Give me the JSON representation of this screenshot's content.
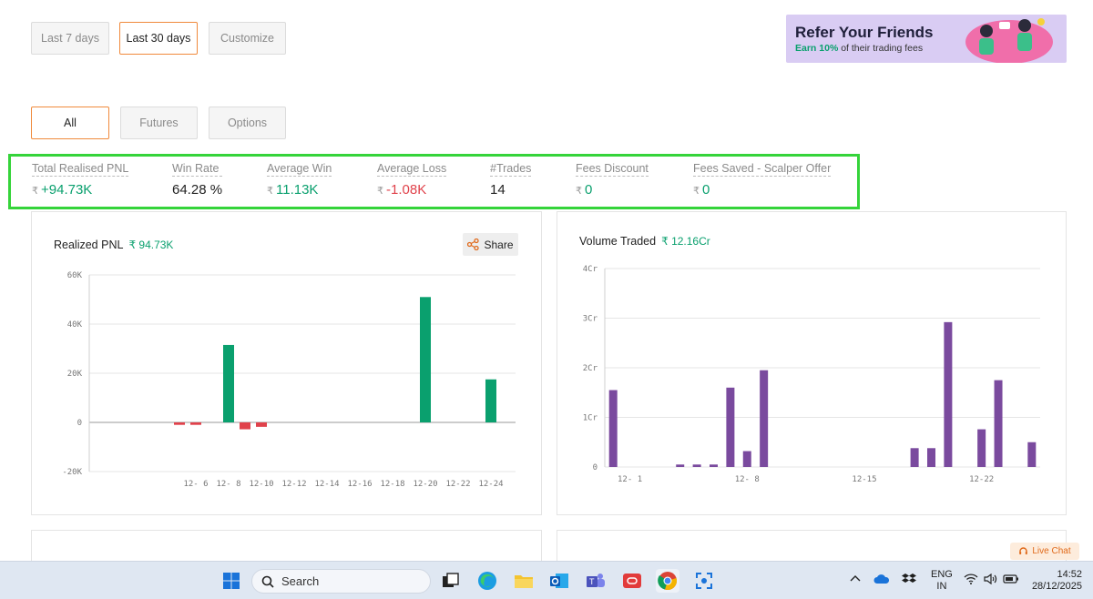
{
  "range_buttons": [
    "Last 7 days",
    "Last 30 days",
    "Customize"
  ],
  "range_selected": "Last 30 days",
  "type_tabs": [
    "All",
    "Futures",
    "Options"
  ],
  "type_selected": "All",
  "refer": {
    "title": "Refer Your Friends",
    "earn": "Earn 10%",
    "rest": " of their trading fees"
  },
  "stats": [
    {
      "label": "Total Realised PNL",
      "currency": "₹",
      "value": "+94.73K",
      "color": "green"
    },
    {
      "label": "Win Rate",
      "currency": "",
      "value": "64.28 %",
      "color": "dark"
    },
    {
      "label": "Average Win",
      "currency": "₹",
      "value": "11.13K",
      "color": "green"
    },
    {
      "label": "Average Loss",
      "currency": "₹",
      "value": "-1.08K",
      "color": "red"
    },
    {
      "label": "#Trades",
      "currency": "",
      "value": "14",
      "color": "dark"
    },
    {
      "label": "Fees Discount",
      "currency": "₹",
      "value": "0",
      "color": "green"
    },
    {
      "label": "Fees Saved - Scalper Offer",
      "currency": "₹",
      "value": "0",
      "color": "green"
    }
  ],
  "pnl_card": {
    "title": "Realized PNL",
    "value": "₹ 94.73K",
    "share_label": "Share"
  },
  "volume_card": {
    "title": "Volume Traded",
    "value": "₹ 12.16Cr"
  },
  "chart_data": [
    {
      "type": "bar",
      "title": "Realized PNL",
      "yticks": [
        "60K",
        "40K",
        "20K",
        "0",
        "-20K"
      ],
      "ylim": [
        -20000,
        60000
      ],
      "xticks": [
        "12- 6",
        "12- 8",
        "12-10",
        "12-12",
        "12-14",
        "12-16",
        "12-18",
        "12-20",
        "12-22",
        "12-24"
      ],
      "x_range": [
        "11-30",
        "12-25"
      ],
      "colors": {
        "positive": "#0aa06e",
        "negative": "#e0424b"
      },
      "series": [
        {
          "values": [
            {
              "x": "12-5",
              "y": -1000
            },
            {
              "x": "12-6",
              "y": -1000
            },
            {
              "x": "12-8",
              "y": 31500
            },
            {
              "x": "12-9",
              "y": -2800
            },
            {
              "x": "12-10",
              "y": -1800
            },
            {
              "x": "12-20",
              "y": 51000
            },
            {
              "x": "12-24",
              "y": 17500
            }
          ]
        }
      ]
    },
    {
      "type": "bar",
      "title": "Volume Traded",
      "yticks": [
        "4Cr",
        "3Cr",
        "2Cr",
        "1Cr",
        "0"
      ],
      "ylim": [
        0,
        4
      ],
      "xticks": [
        "12- 1",
        "12- 8",
        "12-15",
        "12-22"
      ],
      "x_range": [
        "11-30",
        "12-25"
      ],
      "colors": {
        "bar": "#7a4a9e"
      },
      "series": [
        {
          "values": [
            {
              "x": "11-30",
              "y": 1.55
            },
            {
              "x": "12-4",
              "y": 0.05
            },
            {
              "x": "12-5",
              "y": 0.05
            },
            {
              "x": "12-6",
              "y": 0.05
            },
            {
              "x": "12-7",
              "y": 1.6
            },
            {
              "x": "12-8",
              "y": 0.32
            },
            {
              "x": "12-9",
              "y": 1.95
            },
            {
              "x": "12-18",
              "y": 0.38
            },
            {
              "x": "12-19",
              "y": 0.38
            },
            {
              "x": "12-20",
              "y": 2.92
            },
            {
              "x": "12-22",
              "y": 0.76
            },
            {
              "x": "12-23",
              "y": 1.75
            },
            {
              "x": "12-25",
              "y": 0.5
            }
          ]
        }
      ]
    }
  ],
  "live_chat": "Live Chat",
  "taskbar": {
    "search_placeholder": "Search",
    "lang_line1": "ENG",
    "lang_line2": "IN",
    "time": "14:52",
    "date": "28/12/2025"
  }
}
